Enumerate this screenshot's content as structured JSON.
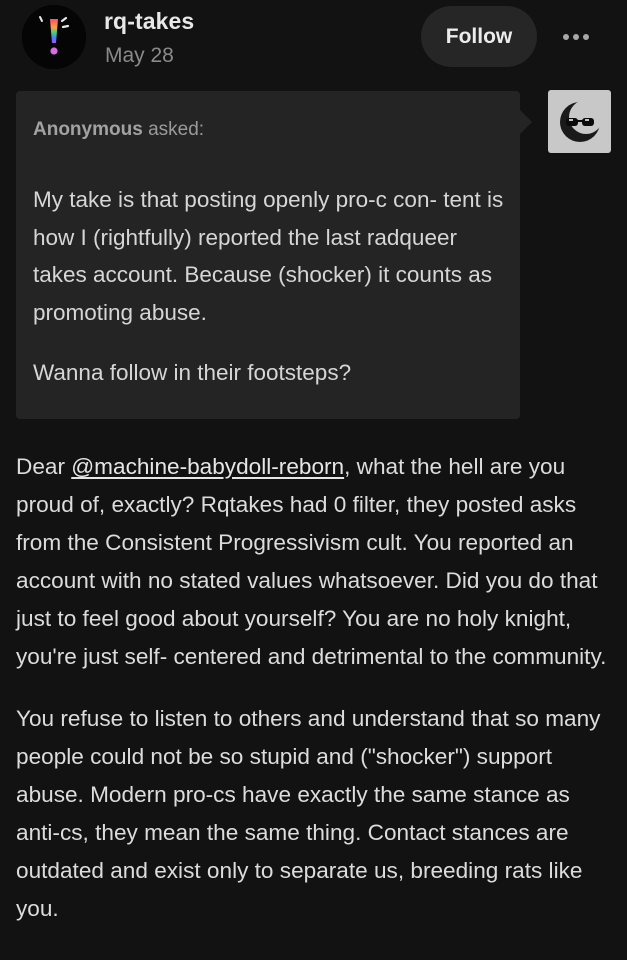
{
  "post": {
    "blog_name": "rq-takes",
    "date": "May 28",
    "follow_label": "Follow",
    "more_icon": "more-horizontal-icon",
    "avatar_icon": "exclamation-pride-icon"
  },
  "ask": {
    "asker_name": "Anonymous",
    "asked_label": "asked:",
    "asker_avatar_icon": "sunglasses-moon-icon",
    "paragraphs": [
      "My take is that posting openly pro-c con- tent is how I (rightfully) reported the last radqueer takes account. Because (shocker) it counts as promoting abuse.",
      "Wanna follow in their footsteps?"
    ]
  },
  "answer": {
    "p1_before": "Dear ",
    "mention": "@machine-babydoll-reborn",
    "p1_after": ", what the hell are you proud of, exactly? Rqtakes had 0 filter, they posted asks from the Consistent Progressivism cult. You reported an account with no stated values whatsoever. Did you do that just to feel good about yourself? You are no holy knight, you're just self- centered and detrimental to the community.",
    "p2": "You refuse to listen to others and understand that so many people could not be so stupid and (\"shocker\") support abuse. Modern pro-cs have exactly the same stance as anti-cs, they mean the same thing. Contact stances are outdated and exist only to separate us, breeding rats like you."
  },
  "colors": {
    "background": "#121212",
    "ask_box": "#242424",
    "text": "#dcdcdc",
    "muted": "#8a8a8a"
  }
}
